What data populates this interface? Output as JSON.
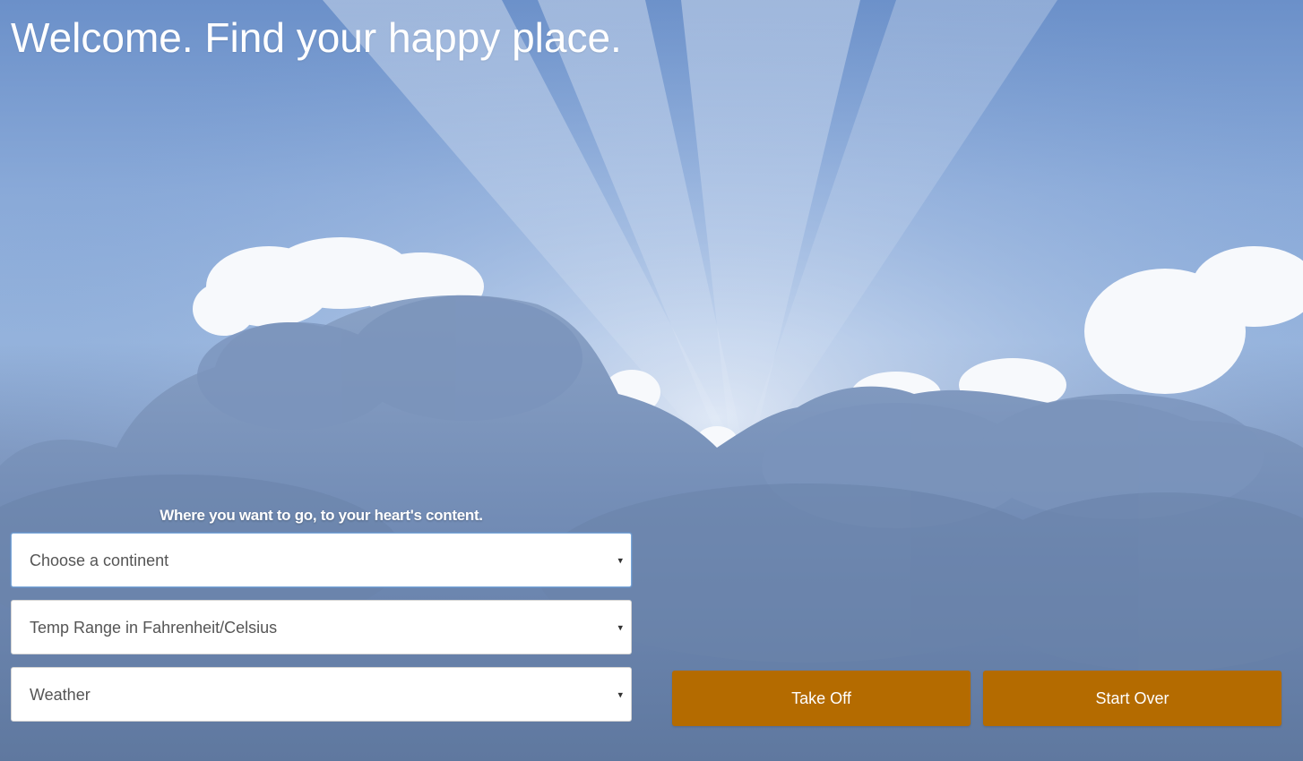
{
  "header": {
    "title": "Welcome. Find your happy place."
  },
  "form": {
    "subtitle": "Where you want to go, to your heart's content.",
    "continent": {
      "selected": "Choose a continent"
    },
    "temp_range": {
      "selected": "Temp Range in Fahrenheit/Celsius"
    },
    "weather": {
      "selected": "Weather"
    },
    "caret_glyph": "▾"
  },
  "actions": {
    "take_off_label": "Take Off",
    "start_over_label": "Start Over"
  },
  "colors": {
    "button_bg": "#b46b00",
    "button_text": "#ffffff",
    "title_text": "#ffffff",
    "sky": "#7fa2d6"
  }
}
